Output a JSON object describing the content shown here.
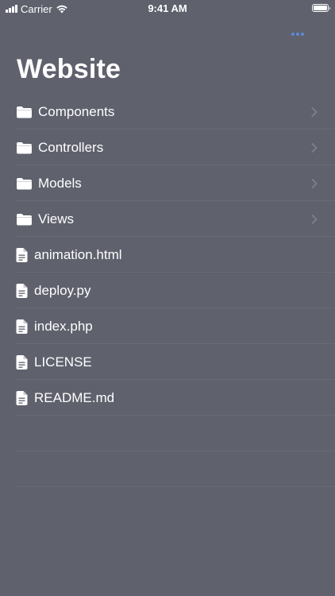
{
  "status_bar": {
    "carrier": "Carrier",
    "time": "9:41 AM"
  },
  "header": {
    "title": "Website",
    "more_icon": "ellipsis-icon",
    "accent_color": "#5b8bd4"
  },
  "folders": [
    {
      "label": "Components",
      "icon": "folder-icon"
    },
    {
      "label": "Controllers",
      "icon": "folder-icon"
    },
    {
      "label": "Models",
      "icon": "folder-icon"
    },
    {
      "label": "Views",
      "icon": "folder-icon"
    }
  ],
  "files": [
    {
      "label": "animation.html",
      "icon": "document-icon"
    },
    {
      "label": "deploy.py",
      "icon": "document-icon"
    },
    {
      "label": "index.php",
      "icon": "document-icon"
    },
    {
      "label": "LICENSE",
      "icon": "document-icon"
    },
    {
      "label": "README.md",
      "icon": "document-icon"
    }
  ],
  "colors": {
    "background": "#5f616d",
    "text": "#ffffff"
  }
}
